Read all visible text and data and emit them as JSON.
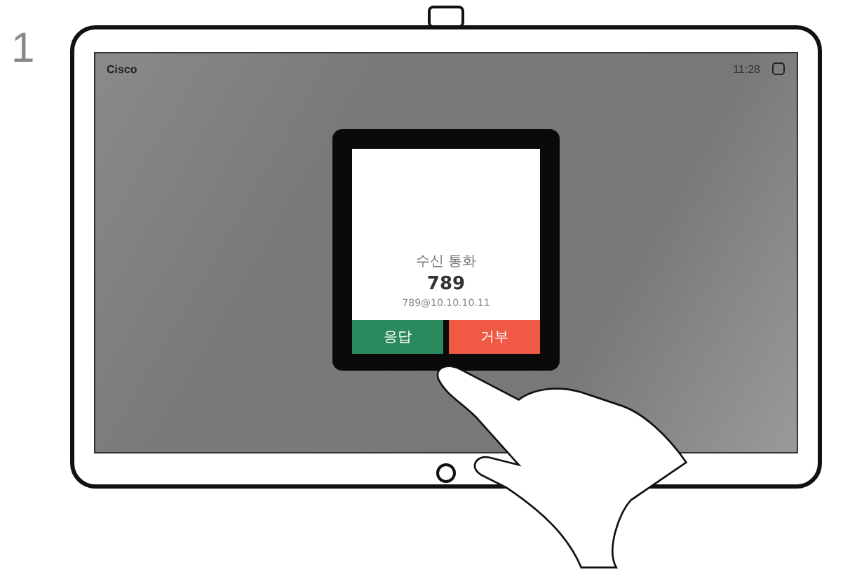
{
  "step": "1",
  "status_bar": {
    "title": "Cisco",
    "time": "11:28"
  },
  "incoming_call": {
    "title": "수신 통화",
    "caller": "789",
    "address": "789@10.10.10.11",
    "buttons": [
      {
        "label": "응답",
        "kind": "accept"
      },
      {
        "label": "거부",
        "kind": "decline"
      }
    ]
  }
}
